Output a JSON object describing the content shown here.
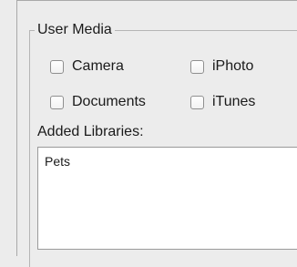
{
  "group": {
    "title": "User Media"
  },
  "checkboxes": [
    {
      "label": "Camera",
      "checked": false
    },
    {
      "label": "iPhoto",
      "checked": false
    },
    {
      "label": "Documents",
      "checked": false
    },
    {
      "label": "iTunes",
      "checked": false
    }
  ],
  "libraries": {
    "label": "Added Libraries:",
    "items": [
      "Pets"
    ]
  }
}
